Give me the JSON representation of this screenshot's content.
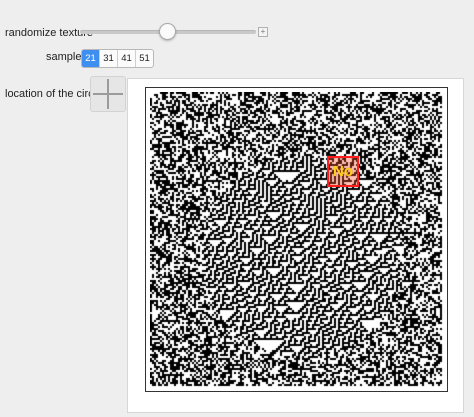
{
  "controls": {
    "texture_label": "randomize texture",
    "sample_label": "sample size",
    "location_label": "location of the circle",
    "sample_options": [
      "21",
      "31",
      "41",
      "51"
    ],
    "selected_sample": "21",
    "slider_position": 0.47,
    "plus_symbol": "+"
  },
  "result": {
    "label": "No"
  },
  "colors": {
    "accent": "#3f8ff0",
    "marker": "#ff1d1d",
    "result_text": "#ffd21a"
  }
}
